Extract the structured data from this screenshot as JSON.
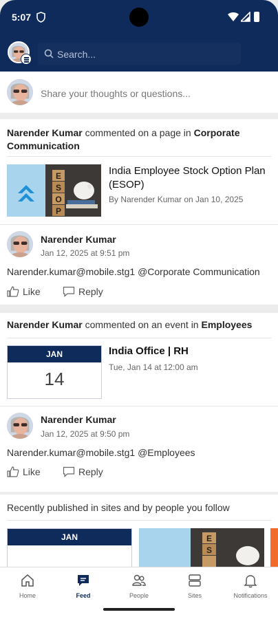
{
  "status_bar": {
    "time": "5:07"
  },
  "header": {
    "search_placeholder": "Search..."
  },
  "composer": {
    "placeholder": "Share your thoughts or questions..."
  },
  "feed": [
    {
      "actor": "Narender Kumar",
      "action": "commented on a page in",
      "target": "Corporate Communication",
      "page": {
        "title": "India Employee Stock Option Plan (ESOP)",
        "byline": "By Narender Kumar on Jan 10, 2025",
        "image_text": "ESOP"
      },
      "comment": {
        "author": "Narender Kumar",
        "time": "Jan 12, 2025 at 9:51 pm",
        "text": "Narender.kumar@mobile.stg1 @Corporate Communication"
      }
    },
    {
      "actor": "Narender Kumar",
      "action": "commented on an event in",
      "target": "Employees",
      "event": {
        "month": "JAN",
        "day": "14",
        "title": "India Office | RH",
        "time": "Tue, Jan 14 at 12:00 am"
      },
      "comment": {
        "author": "Narender Kumar",
        "time": "Jan 12, 2025 at 9:50 pm",
        "text": "Narender.kumar@mobile.stg1 @Employees"
      }
    }
  ],
  "actions": {
    "like": "Like",
    "reply": "Reply"
  },
  "recent": {
    "title": "Recently published in sites and by people you follow",
    "cal_month": "JAN"
  },
  "nav": [
    {
      "label": "Home",
      "icon": "home-icon"
    },
    {
      "label": "Feed",
      "icon": "feed-icon",
      "active": true
    },
    {
      "label": "People",
      "icon": "people-icon"
    },
    {
      "label": "Sites",
      "icon": "sites-icon"
    },
    {
      "label": "Notifications",
      "icon": "bell-icon"
    }
  ],
  "colors": {
    "brand_navy": "#0f2b5b",
    "accent_orange": "#f26b2b"
  }
}
